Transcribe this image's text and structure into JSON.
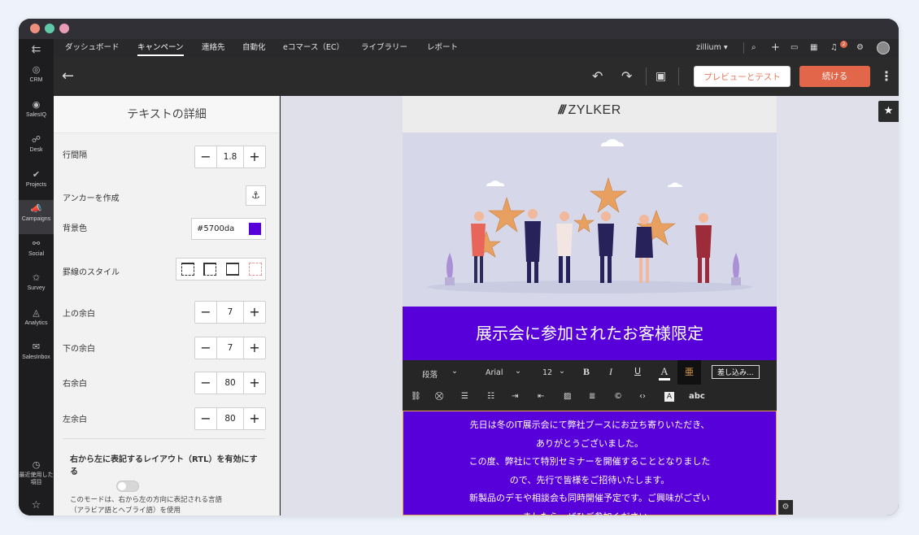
{
  "sidebar": {
    "items": [
      {
        "label": "CRM",
        "icon": "crm-icon"
      },
      {
        "label": "SalesIQ",
        "icon": "salesiq-icon"
      },
      {
        "label": "Desk",
        "icon": "desk-icon"
      },
      {
        "label": "Projects",
        "icon": "projects-icon"
      },
      {
        "label": "Campaigns",
        "icon": "campaigns-icon"
      },
      {
        "label": "Social",
        "icon": "social-icon"
      },
      {
        "label": "Survey",
        "icon": "survey-icon"
      },
      {
        "label": "Analytics",
        "icon": "analytics-icon"
      },
      {
        "label": "SalesInbox",
        "icon": "salesinbox-icon"
      }
    ],
    "recent_label": "最近使用した項目"
  },
  "nav": {
    "items": [
      "ダッシュボード",
      "キャンペーン",
      "連絡先",
      "自動化",
      "eコマース（EC）",
      "ライブラリー",
      "レポート"
    ],
    "active": "キャンペーン",
    "org": "zillium ▾",
    "notification_count": "2"
  },
  "toolbar": {
    "preview_label": "プレビューとテスト",
    "continue_label": "続ける"
  },
  "panel": {
    "title": "テキストの詳細",
    "line_height_label": "行間隔",
    "line_height_value": "1.8",
    "anchor_label": "アンカーを作成",
    "bg_color_label": "背景色",
    "bg_color_value": "#5700da",
    "border_style_label": "罫線のスタイル",
    "top_padding_label": "上の余白",
    "top_padding_value": "7",
    "bottom_padding_label": "下の余白",
    "bottom_padding_value": "7",
    "right_padding_label": "右余白",
    "right_padding_value": "80",
    "left_padding_label": "左余白",
    "left_padding_value": "80",
    "rtl_label": "右から左に表記するレイアウト（RTL）を有効にする",
    "rtl_desc": "このモードは、右から左の方向に表記される言語（アラビア語とヘブライ語）を使用"
  },
  "email": {
    "logo_text": "ZYLKER",
    "banner_text": "展示会に参加されたお客様限定",
    "body_lines": [
      "先日は冬のIT展示会にて弊社ブースにお立ち寄りいただき、",
      "ありがとうございました。",
      "この度、弊社にて特別セミナーを開催することとなりました",
      "ので、先行で皆様をご招待いたします。",
      "新製品のデモや相談会も同時開催予定です。ご興味がござい",
      "ましたら、ぜひご参加ください。"
    ]
  },
  "format_bar": {
    "paragraph": "段落",
    "font": "Arial",
    "size": "12",
    "bold": "B",
    "italic": "I",
    "underline": "U",
    "text_color": "A",
    "highlight": "亜",
    "merge_tags": "差し込み...",
    "spellcheck": "abc"
  },
  "colors": {
    "accent": "#e2674a",
    "brand_purple": "#5700da"
  }
}
